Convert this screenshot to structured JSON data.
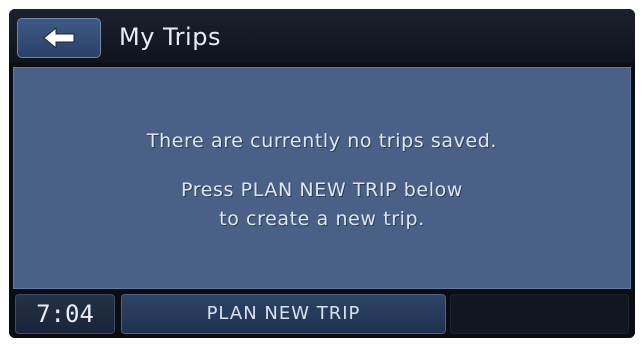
{
  "header": {
    "back_icon": "left-arrow-icon",
    "title": "My Trips"
  },
  "content": {
    "message_line1": "There are currently no trips saved.",
    "message_line2": "Press PLAN NEW TRIP below",
    "message_line3": "to create a new trip."
  },
  "bottom_bar": {
    "clock": "7:04",
    "plan_button_label": "PLAN NEW TRIP"
  },
  "colors": {
    "panel_bg": "#4a6086",
    "frame_bg": "#0a0d14",
    "button_blue": "#3d5a86",
    "text": "#e9edf3"
  }
}
